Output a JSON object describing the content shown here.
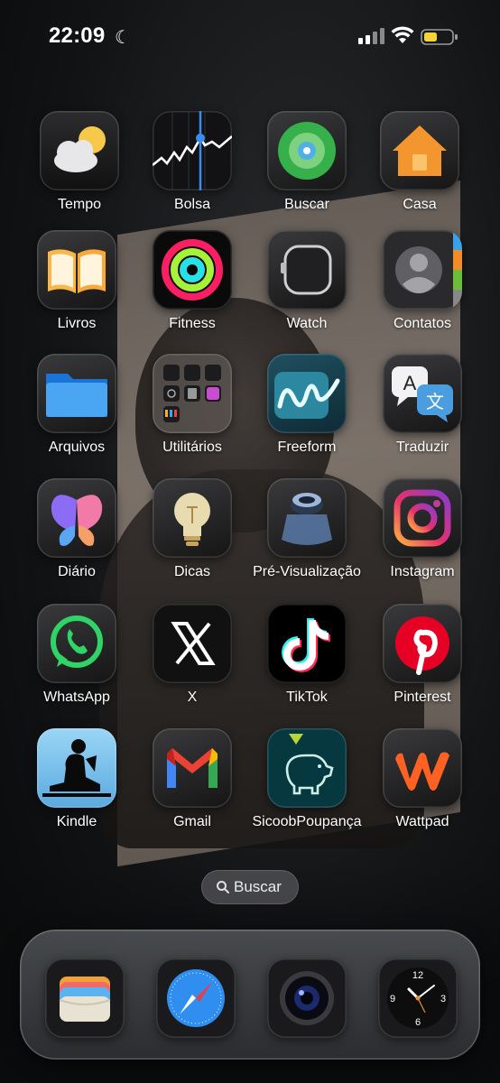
{
  "status_bar": {
    "time": "22:09"
  },
  "apps": [
    {
      "label": "Tempo"
    },
    {
      "label": "Bolsa"
    },
    {
      "label": "Buscar"
    },
    {
      "label": "Casa"
    },
    {
      "label": "Livros"
    },
    {
      "label": "Fitness"
    },
    {
      "label": "Watch"
    },
    {
      "label": "Contatos"
    },
    {
      "label": "Arquivos"
    },
    {
      "label": "Utilitários"
    },
    {
      "label": "Freeform"
    },
    {
      "label": "Traduzir"
    },
    {
      "label": "Diário"
    },
    {
      "label": "Dicas"
    },
    {
      "label": "Pré-Visualização"
    },
    {
      "label": "Instagram"
    },
    {
      "label": "WhatsApp"
    },
    {
      "label": "X"
    },
    {
      "label": "TikTok"
    },
    {
      "label": "Pinterest"
    },
    {
      "label": "Kindle"
    },
    {
      "label": "Gmail"
    },
    {
      "label": "SicoobPoupança"
    },
    {
      "label": "Wattpad"
    }
  ],
  "search": {
    "label": "Buscar"
  },
  "dock": [
    {
      "name": "Wallet"
    },
    {
      "name": "Safari"
    },
    {
      "name": "Camera"
    },
    {
      "name": "Clock"
    }
  ],
  "clock_numbers": [
    "12",
    "3",
    "6",
    "9"
  ],
  "translate_glyphs": [
    "A",
    "文"
  ]
}
